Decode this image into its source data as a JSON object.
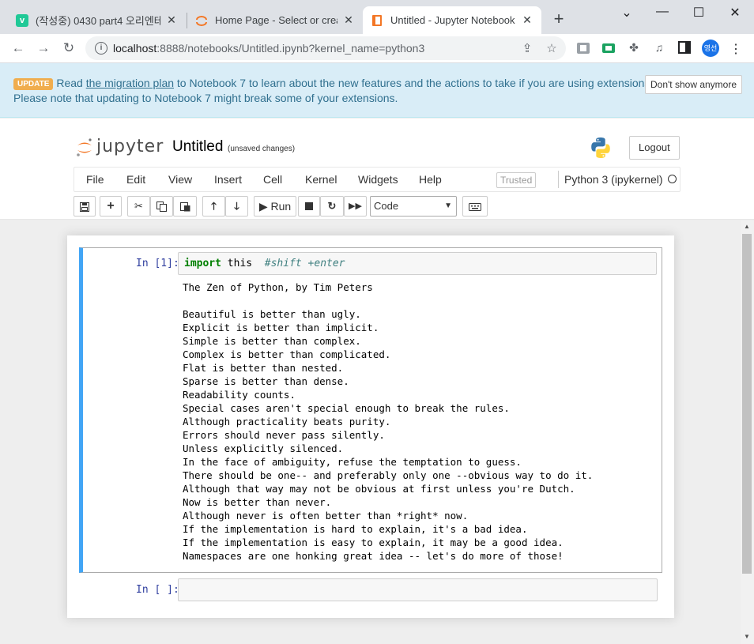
{
  "browser": {
    "tabs": [
      {
        "title": "(작성중) 0430 part4 오리엔테",
        "favicon_letter": "v",
        "favicon_color": "#20c997",
        "active": false
      },
      {
        "title": "Home Page - Select or create",
        "favicon_color": "#f37726",
        "active": false
      },
      {
        "title": "Untitled - Jupyter Notebook",
        "favicon_color": "#f37726",
        "active": true
      }
    ],
    "url_host": "localhost",
    "url_rest": ":8888/notebooks/Untitled.ipynb?kernel_name=python3",
    "profile_initials": "영선"
  },
  "banner": {
    "badge": "UPDATE",
    "text_before_link": "Read ",
    "link_text": "the migration plan",
    "text_after_link": " to Notebook 7 to learn about the new features and the actions to take if you are using extensions -",
    "line2": "Please note that updating to Notebook 7 might break some of your extensions.",
    "dont_show": "Don't show anymore"
  },
  "header": {
    "logo_text": "jupyter",
    "notebook_name": "Untitled",
    "save_status": "(unsaved changes)",
    "logout": "Logout"
  },
  "menubar": {
    "items": [
      "File",
      "Edit",
      "View",
      "Insert",
      "Cell",
      "Kernel",
      "Widgets",
      "Help"
    ],
    "trusted": "Trusted",
    "kernel": "Python 3 (ipykernel)"
  },
  "toolbar": {
    "run_label": "Run",
    "cell_type": "Code"
  },
  "cells": [
    {
      "prompt": "In [1]:",
      "code_keyword": "import",
      "code_rest": " this  ",
      "code_comment": "#shift +enter",
      "output": "The Zen of Python, by Tim Peters\n\nBeautiful is better than ugly.\nExplicit is better than implicit.\nSimple is better than complex.\nComplex is better than complicated.\nFlat is better than nested.\nSparse is better than dense.\nReadability counts.\nSpecial cases aren't special enough to break the rules.\nAlthough practicality beats purity.\nErrors should never pass silently.\nUnless explicitly silenced.\nIn the face of ambiguity, refuse the temptation to guess.\nThere should be one-- and preferably only one --obvious way to do it.\nAlthough that way may not be obvious at first unless you're Dutch.\nNow is better than never.\nAlthough never is often better than *right* now.\nIf the implementation is hard to explain, it's a bad idea.\nIf the implementation is easy to explain, it may be a good idea.\nNamespaces are one honking great idea -- let's do more of those!"
    },
    {
      "prompt": "In [ ]:"
    }
  ],
  "colors": {
    "selected_cell_border": "#42a5f5",
    "prompt": "#303f9f",
    "banner_bg": "#d9edf7",
    "badge": "#f0ad4e"
  }
}
